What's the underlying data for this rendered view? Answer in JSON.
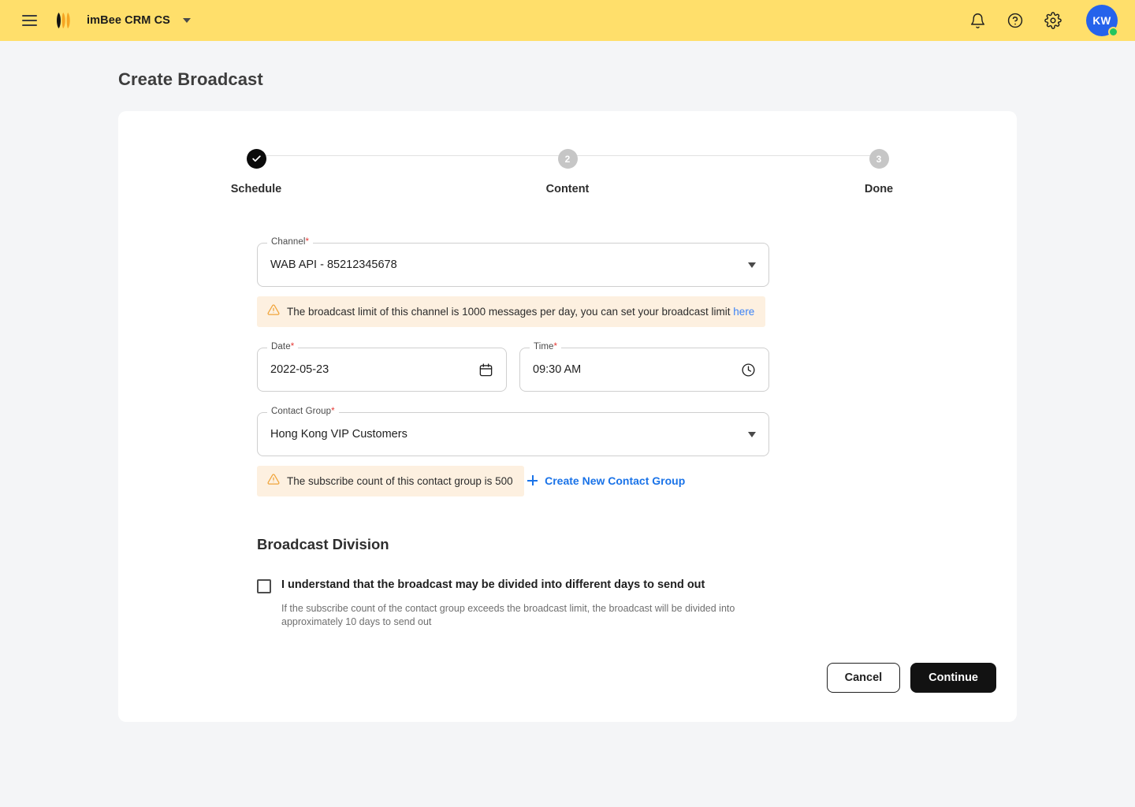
{
  "topbar": {
    "menu_icon": "hamburger-icon",
    "logo_icon": "imbee-logo",
    "workspace": "imBee CRM CS",
    "workspace_caret_icon": "chevron-down-icon",
    "notifications_icon": "bell-icon",
    "help_icon": "question-circle-icon",
    "settings_icon": "gear-icon",
    "avatar_initials": "KW",
    "brand_color": "#ffdf6b",
    "avatar_color": "#2563eb",
    "presence_color": "#22c55e"
  },
  "page": {
    "title": "Create Broadcast"
  },
  "stepper": {
    "steps": [
      {
        "label": "Schedule",
        "indicator": "check-icon",
        "state": "done"
      },
      {
        "label": "Content",
        "indicator": "2",
        "state": "upcoming"
      },
      {
        "label": "Done",
        "indicator": "3",
        "state": "upcoming"
      }
    ]
  },
  "form": {
    "channel": {
      "legend": "Channel",
      "required": "*",
      "value": "WAB API - 85212345678",
      "caret_icon": "chevron-down-icon"
    },
    "channel_alert": {
      "icon": "warning-triangle-icon",
      "text": "The broadcast limit of this channel is 1000 messages per day, you can set your broadcast limit ",
      "link": "here",
      "link_color": "#3b82f6",
      "bg_color": "#fdf0e0"
    },
    "date": {
      "legend": "Date",
      "required": "*",
      "value": "2022-05-23",
      "icon": "calendar-icon"
    },
    "time": {
      "legend": "Time",
      "required": "*",
      "value": "09:30 AM",
      "icon": "clock-icon"
    },
    "contact_group": {
      "legend": "Contact Group",
      "required": "*",
      "value": "Hong Kong VIP Customers",
      "caret_icon": "chevron-down-icon"
    },
    "contact_group_alert": {
      "icon": "warning-triangle-icon",
      "text": "The subscribe count of this contact group is 500"
    },
    "create_group_link": {
      "icon": "plus-icon",
      "label": "Create New Contact Group"
    }
  },
  "broadcast_division": {
    "title": "Broadcast Division",
    "checkbox_label": "I understand that the broadcast may be divided into different days to send out",
    "checked": false,
    "help_text": "If the subscribe count of the contact group exceeds the broadcast limit, the broadcast will be divided into approximately 10 days to send out"
  },
  "actions": {
    "cancel_label": "Cancel",
    "continue_label": "Continue"
  }
}
